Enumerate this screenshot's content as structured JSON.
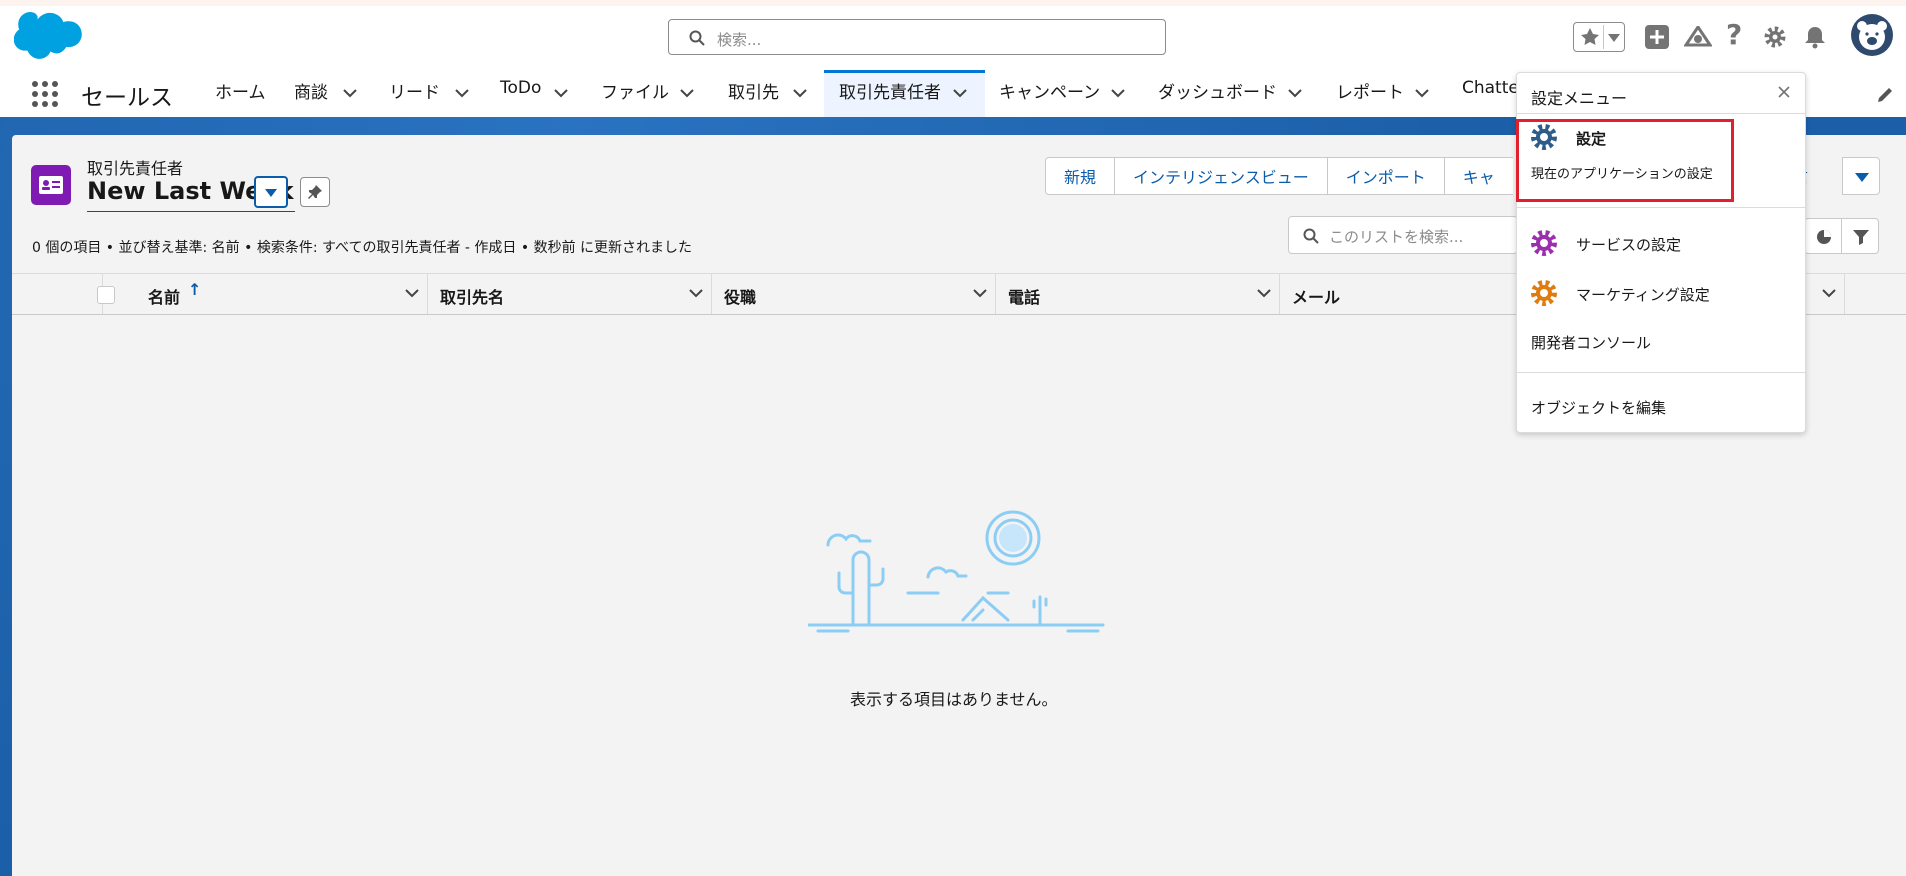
{
  "header": {
    "search_placeholder": "検索...",
    "icons": [
      "salesforce-cloud-logo",
      "search-icon",
      "star-icon",
      "chevron-down-icon",
      "add-icon",
      "trailhead-icon",
      "help-icon",
      "gear-icon",
      "bell-icon",
      "avatar"
    ]
  },
  "nav": {
    "app_name": "セールス",
    "items": [
      {
        "label": "ホーム"
      },
      {
        "label": "商談"
      },
      {
        "label": "リード"
      },
      {
        "label": "ToDo"
      },
      {
        "label": "ファイル"
      },
      {
        "label": "取引先"
      },
      {
        "label": "取引先責任者"
      },
      {
        "label": "キャンペーン"
      },
      {
        "label": "ダッシュボード"
      },
      {
        "label": "レポート"
      },
      {
        "label": "Chatter"
      }
    ]
  },
  "list": {
    "object_label": "取引先責任者",
    "view_name": "New Last Week",
    "status_text": "0 個の項目 • 並び替え基準: 名前 • 検索条件: すべての取引先責任者 - 作成日 • 数秒前 に更新されました",
    "buttons": [
      "新規",
      "インテリジェンスビュー",
      "インポート",
      "キャ"
    ],
    "send_partial": "信",
    "search_placeholder": "このリストを検索...",
    "columns": [
      "名前",
      "取引先名",
      "役職",
      "電話",
      "メール"
    ],
    "sort_arrow": "↑",
    "empty_message": "表示する項目はありません。"
  },
  "setup_menu": {
    "title": "設定メニュー",
    "items": [
      {
        "label": "設定",
        "description": "現在のアプリケーションの設定",
        "icon": "gear-icon",
        "color": "#2e5d8a"
      },
      {
        "label": "サービスの設定",
        "icon": "gear-icon",
        "color": "#9b2fae"
      },
      {
        "label": "マーケティング設定",
        "icon": "gear-icon",
        "color": "#e07b10"
      },
      {
        "label": "開発者コンソール"
      },
      {
        "label": "オブジェクトを編集"
      }
    ]
  },
  "colors": {
    "accent": "#0176d3",
    "link": "#0b5cab",
    "band": "#1b5fa8",
    "object_icon": "#7f1bb3",
    "highlight": "#e0202e"
  }
}
